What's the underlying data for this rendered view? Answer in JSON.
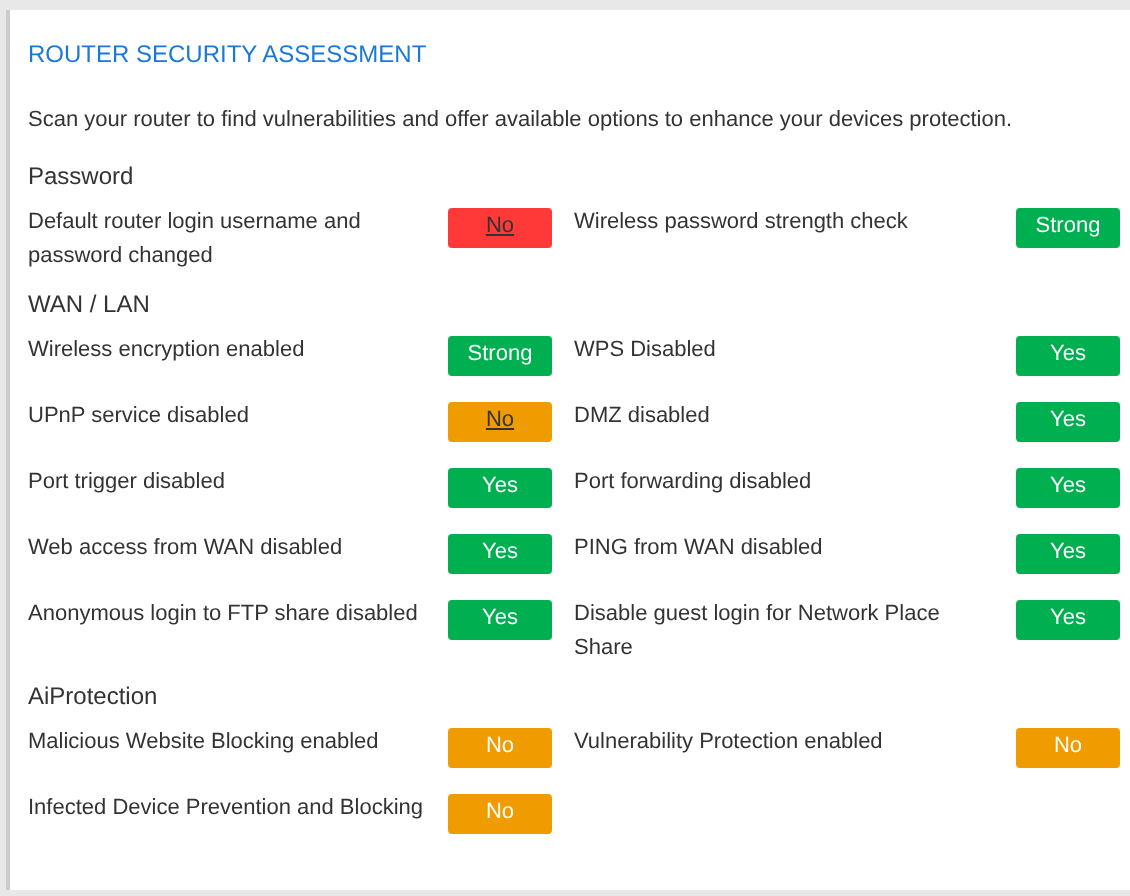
{
  "title": "ROUTER SECURITY ASSESSMENT",
  "description": "Scan your router to find vulnerabilities and offer available options to enhance your devices protection.",
  "sections": [
    {
      "name": "Password",
      "items": [
        {
          "label": "Default router login username and password changed",
          "result": "No",
          "color": "#ff3838",
          "link": true
        },
        {
          "label": "Wireless password strength check",
          "result": "Strong",
          "color": "#00b050",
          "link": false
        }
      ]
    },
    {
      "name": "WAN / LAN",
      "items": [
        {
          "label": "Wireless encryption enabled",
          "result": "Strong",
          "color": "#00b050",
          "link": false
        },
        {
          "label": "WPS Disabled",
          "result": "Yes",
          "color": "#00b050",
          "link": false
        },
        {
          "label": "UPnP service disabled",
          "result": "No",
          "color": "#f09b00",
          "link": true
        },
        {
          "label": "DMZ disabled",
          "result": "Yes",
          "color": "#00b050",
          "link": false
        },
        {
          "label": "Port trigger disabled",
          "result": "Yes",
          "color": "#00b050",
          "link": false
        },
        {
          "label": "Port forwarding disabled",
          "result": "Yes",
          "color": "#00b050",
          "link": false
        },
        {
          "label": "Web access from WAN disabled",
          "result": "Yes",
          "color": "#00b050",
          "link": false
        },
        {
          "label": "PING from WAN disabled",
          "result": "Yes",
          "color": "#00b050",
          "link": false
        },
        {
          "label": "Anonymous login to FTP share disabled",
          "result": "Yes",
          "color": "#00b050",
          "link": false
        },
        {
          "label": "Disable guest login for Network Place Share",
          "result": "Yes",
          "color": "#00b050",
          "link": false
        }
      ]
    },
    {
      "name": "AiProtection",
      "items": [
        {
          "label": "Malicious Website Blocking enabled",
          "result": "No",
          "color": "#f09b00",
          "link": false
        },
        {
          "label": "Vulnerability Protection enabled",
          "result": "No",
          "color": "#f09b00",
          "link": false
        },
        {
          "label": "Infected Device Prevention and Blocking",
          "result": "No",
          "color": "#f09b00",
          "link": false
        }
      ]
    }
  ]
}
